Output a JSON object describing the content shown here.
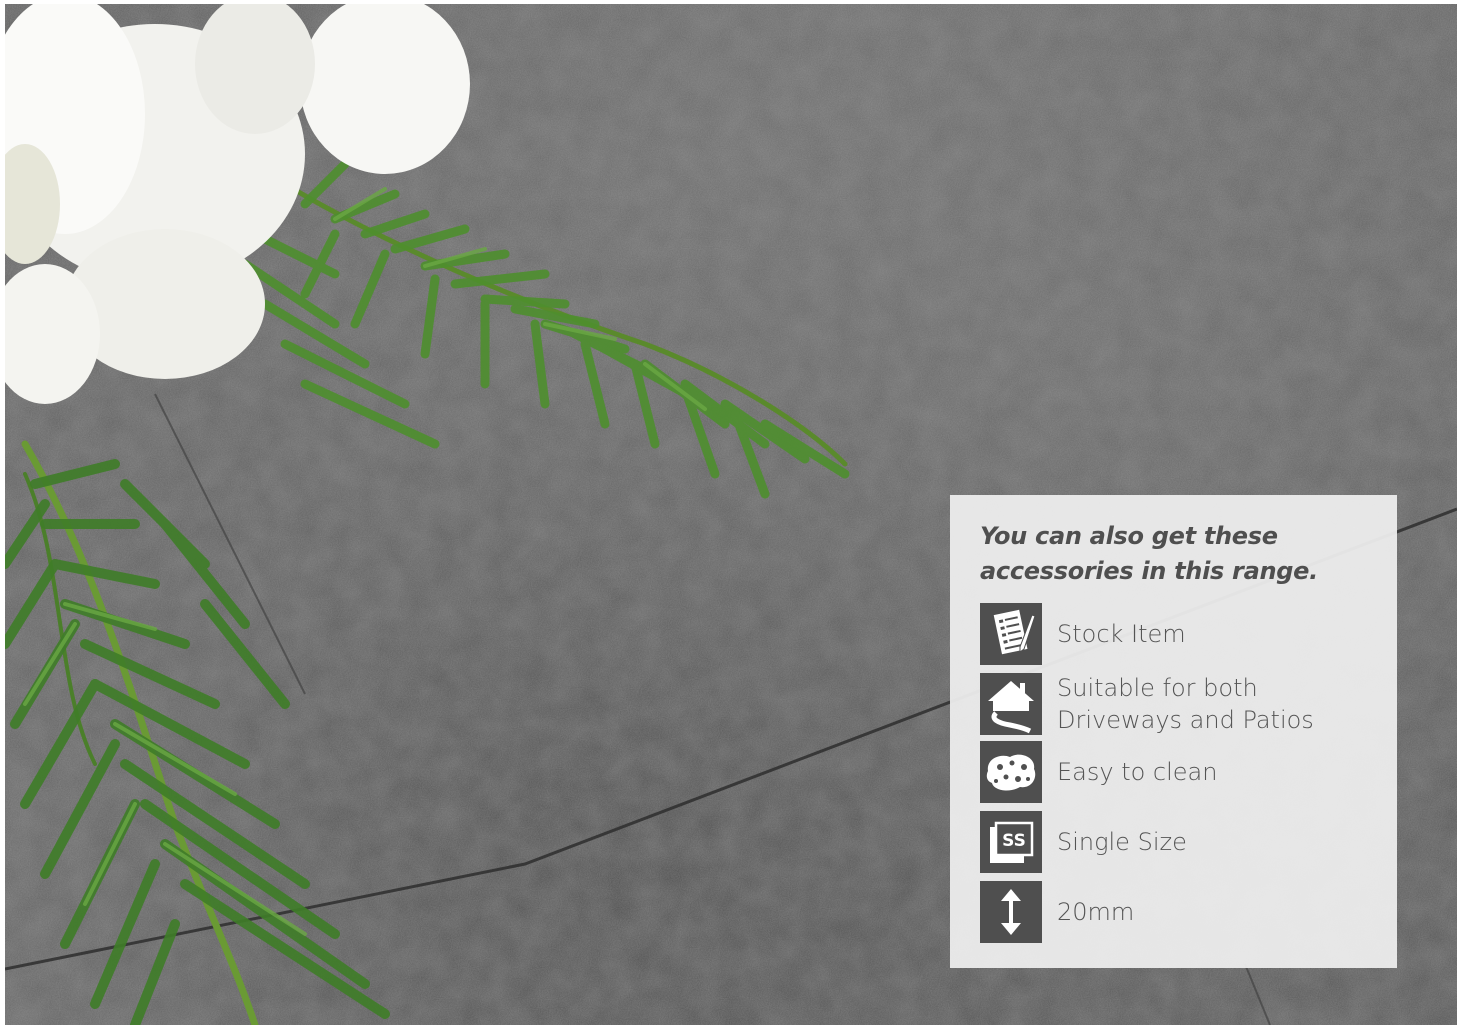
{
  "colors": {
    "panel_background": "#eeeeee",
    "icon_background": "#4f4f4f",
    "text": "#545454",
    "stone_tile": "#5f5f5f",
    "foliage": "#4e8f2e",
    "flower": "#f6f6f2"
  },
  "panel": {
    "heading": "You can also get these accessories in this range.",
    "features": [
      {
        "icon": "stock-item-icon",
        "label": "Stock Item"
      },
      {
        "icon": "driveway-patio-icon",
        "label": "Suitable for both\nDriveways and Patios"
      },
      {
        "icon": "sponge-icon",
        "label": "Easy to clean"
      },
      {
        "icon": "single-size-icon",
        "label": "Single Size"
      },
      {
        "icon": "thickness-arrow-icon",
        "label": "20mm"
      }
    ]
  }
}
